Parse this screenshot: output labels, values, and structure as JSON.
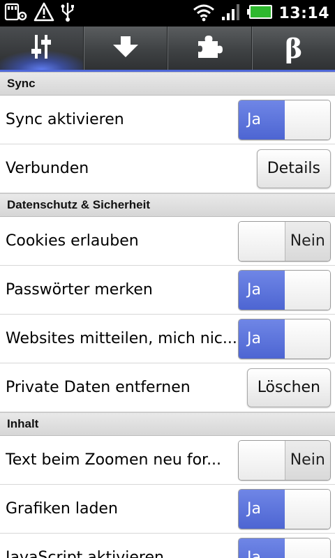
{
  "status_bar": {
    "time": "13:14",
    "icons": [
      "sd-card-settings-icon",
      "warning-icon",
      "usb-icon",
      "wifi-icon",
      "signal-icon",
      "battery-icon"
    ]
  },
  "tabs": [
    {
      "icon": "sliders-icon",
      "active": true
    },
    {
      "icon": "download-arrow-icon",
      "active": false
    },
    {
      "icon": "puzzle-piece-icon",
      "active": false
    },
    {
      "icon": "beta-icon",
      "glyph": "β",
      "active": false
    }
  ],
  "colors": {
    "accent": "#4f68d8",
    "toggle_on": "#5a72dc"
  },
  "sections": [
    {
      "title": "Sync",
      "rows": [
        {
          "label": "Sync aktivieren",
          "control": "toggle",
          "state": "on",
          "on_label": "Ja",
          "off_label": "Nein"
        },
        {
          "label": "Verbunden",
          "control": "button",
          "button_label": "Details"
        }
      ]
    },
    {
      "title": "Datenschutz & Sicherheit",
      "rows": [
        {
          "label": "Cookies erlauben",
          "control": "toggle",
          "state": "off",
          "on_label": "Ja",
          "off_label": "Nein"
        },
        {
          "label": "Passwörter merken",
          "control": "toggle",
          "state": "on",
          "on_label": "Ja",
          "off_label": "Nein"
        },
        {
          "label": "Websites mitteilen, mich nic...",
          "control": "toggle",
          "state": "on",
          "on_label": "Ja",
          "off_label": "Nein"
        },
        {
          "label": "Private Daten entfernen",
          "control": "button",
          "button_label": "Löschen"
        }
      ]
    },
    {
      "title": "Inhalt",
      "rows": [
        {
          "label": "Text beim Zoomen neu for...",
          "control": "toggle",
          "state": "off",
          "on_label": "Ja",
          "off_label": "Nein"
        },
        {
          "label": "Grafiken laden",
          "control": "toggle",
          "state": "on",
          "on_label": "Ja",
          "off_label": "Nein"
        },
        {
          "label": "JavaScript aktivieren",
          "control": "toggle",
          "state": "on",
          "on_label": "Ja",
          "off_label": "Nein"
        }
      ]
    }
  ]
}
